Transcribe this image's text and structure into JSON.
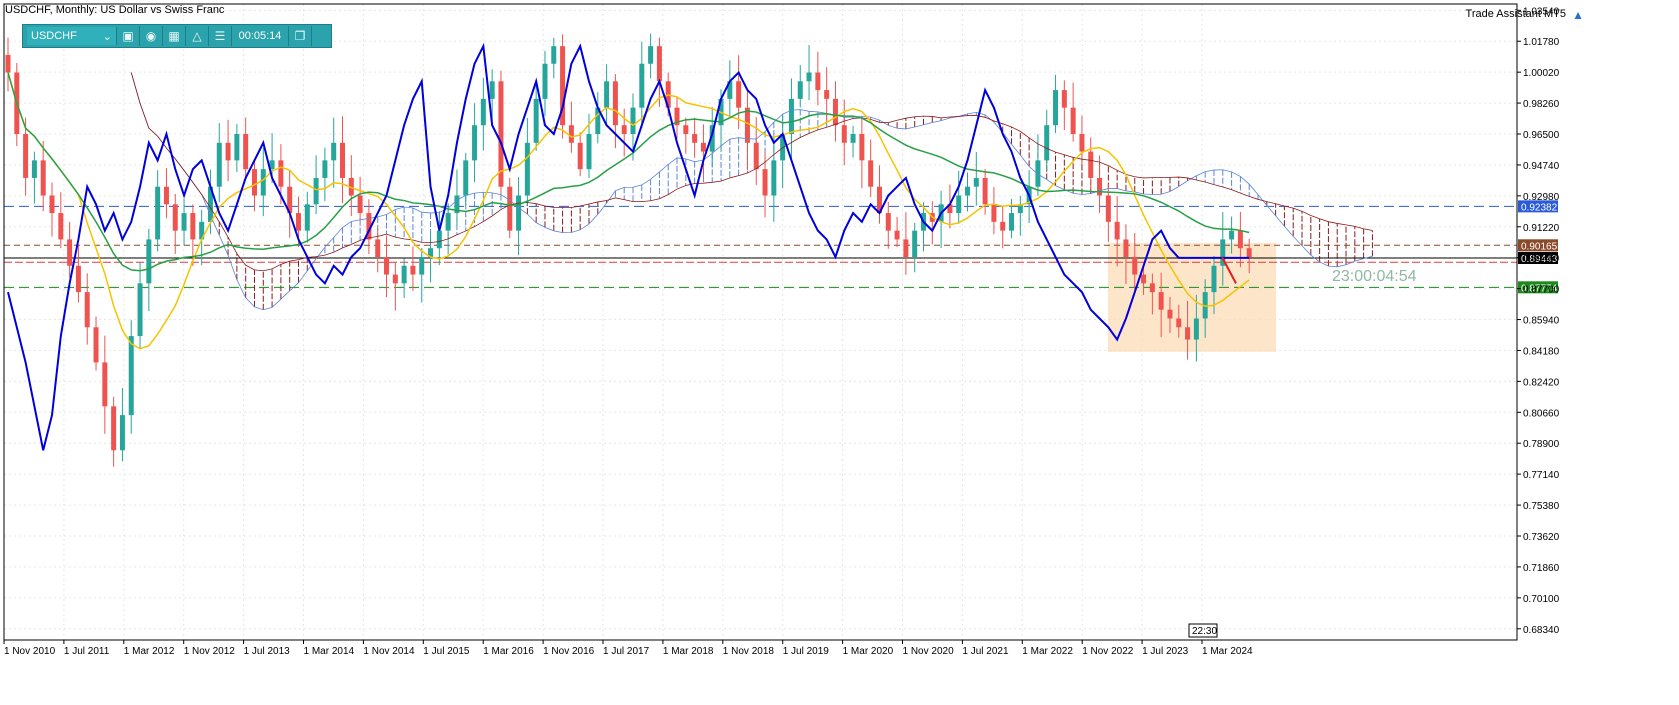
{
  "header": {
    "title": "USDCHF, Monthly:  US Dollar vs Swiss Franc",
    "trade_assistant": "Trade Assistant MT5"
  },
  "toolbar": {
    "symbol": "USDCHF",
    "timer": "00:05:14"
  },
  "countdown": "23:00:04:54",
  "time_marker": "22:30",
  "colors": {
    "bull": "#26a69a",
    "bear": "#ef5350",
    "blue_line": "#0000dd",
    "yellow_line": "#f5c400",
    "green_line": "#27a045",
    "cloud_red": "#8b1a1a",
    "cloud_blue": "#5c86d6",
    "zone": "#fcdcb8"
  },
  "chart_data": {
    "type": "candlestick",
    "title": "USDCHF, Monthly:  US Dollar vs Swiss Franc",
    "ylim": [
      0.677,
      1.039
    ],
    "y_ticks": [
      "1.03540",
      "1.01780",
      "1.00020",
      "0.98260",
      "0.96500",
      "0.94740",
      "0.92980",
      "0.91220",
      "0.89460",
      "0.87700",
      "0.85940",
      "0.84180",
      "0.82420",
      "0.80660",
      "0.78900",
      "0.77140",
      "0.75380",
      "0.73620",
      "0.71860",
      "0.70100",
      "0.68340"
    ],
    "x_ticks": [
      "1 Nov 2010",
      "1 Jul 2011",
      "1 Mar 2012",
      "1 Nov 2012",
      "1 Jul 2013",
      "1 Mar 2014",
      "1 Nov 2014",
      "1 Jul 2015",
      "1 Mar 2016",
      "1 Nov 2016",
      "1 Jul 2017",
      "1 Mar 2018",
      "1 Nov 2018",
      "1 Jul 2019",
      "1 Mar 2020",
      "1 Nov 2020",
      "1 Jul 2021",
      "1 Mar 2022",
      "1 Nov 2022",
      "1 Jul 2023",
      "1 Mar 2024"
    ],
    "price_labels": [
      {
        "value": 0.92382,
        "label": "0.92382",
        "color": "#2a5bd7"
      },
      {
        "value": 0.90165,
        "label": "0.90165",
        "color": "#8b4a2a"
      },
      {
        "value": 0.89443,
        "label": "0.89443",
        "color": "#000000"
      },
      {
        "value": 0.87774,
        "label": "0.87774",
        "color": "#1a8a1a"
      }
    ],
    "closes": [
      1.0,
      0.965,
      0.94,
      0.95,
      0.93,
      0.92,
      0.905,
      0.89,
      0.875,
      0.855,
      0.835,
      0.81,
      0.785,
      0.805,
      0.85,
      0.88,
      0.905,
      0.935,
      0.925,
      0.91,
      0.92,
      0.905,
      0.915,
      0.935,
      0.96,
      0.95,
      0.965,
      0.945,
      0.93,
      0.945,
      0.95,
      0.935,
      0.92,
      0.91,
      0.925,
      0.94,
      0.95,
      0.96,
      0.94,
      0.93,
      0.92,
      0.905,
      0.895,
      0.885,
      0.88,
      0.89,
      0.885,
      0.895,
      0.9,
      0.91,
      0.92,
      0.93,
      0.95,
      0.97,
      0.985,
      0.995,
      0.935,
      0.91,
      0.93,
      0.96,
      0.985,
      1.005,
      1.015,
      0.97,
      0.96,
      0.945,
      0.965,
      0.98,
      0.995,
      0.97,
      0.965,
      0.98,
      1.005,
      1.015,
      0.995,
      0.98,
      0.97,
      0.965,
      0.96,
      0.955,
      0.97,
      0.985,
      0.995,
      0.98,
      0.96,
      0.945,
      0.93,
      0.95,
      0.965,
      0.985,
      0.995,
      1.0,
      0.99,
      0.985,
      0.97,
      0.96,
      0.965,
      0.95,
      0.935,
      0.92,
      0.91,
      0.905,
      0.895,
      0.91,
      0.92,
      0.915,
      0.925,
      0.92,
      0.93,
      0.935,
      0.94,
      0.925,
      0.915,
      0.91,
      0.92,
      0.925,
      0.935,
      0.95,
      0.97,
      0.99,
      0.98,
      0.965,
      0.955,
      0.94,
      0.93,
      0.915,
      0.905,
      0.895,
      0.885,
      0.88,
      0.875,
      0.865,
      0.86,
      0.855,
      0.848,
      0.86,
      0.875,
      0.89,
      0.905,
      0.91,
      0.9,
      0.8945
    ]
  }
}
